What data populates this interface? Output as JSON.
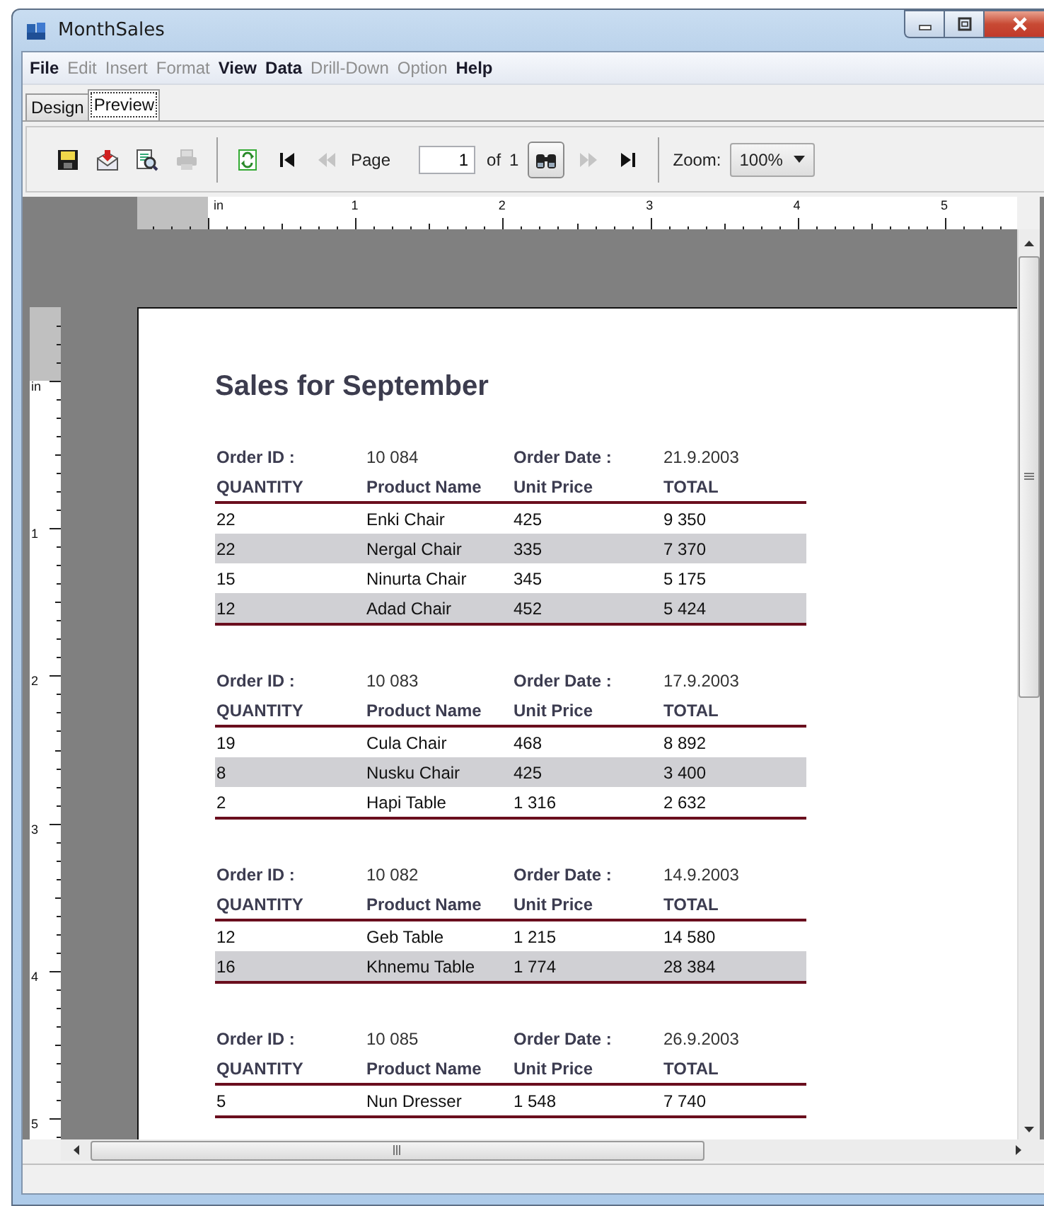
{
  "window": {
    "title": "MonthSales",
    "controls": [
      {
        "kind": "minimize"
      },
      {
        "kind": "maximize"
      },
      {
        "kind": "close"
      }
    ]
  },
  "menu": [
    {
      "label": "File",
      "disabled": false
    },
    {
      "label": "Edit",
      "disabled": true
    },
    {
      "label": "Insert",
      "disabled": true
    },
    {
      "label": "Format",
      "disabled": true
    },
    {
      "label": "View",
      "disabled": false
    },
    {
      "label": "Data",
      "disabled": false
    },
    {
      "label": "Drill-Down",
      "disabled": true
    },
    {
      "label": "Option",
      "disabled": true
    },
    {
      "label": "Help",
      "disabled": false
    }
  ],
  "tabs": [
    {
      "label": "Design",
      "selected": false
    },
    {
      "label": "Preview",
      "selected": true
    }
  ],
  "toolbar": {
    "items": [
      {
        "kind": "save",
        "disabled": false
      },
      {
        "kind": "export",
        "disabled": false
      },
      {
        "kind": "preview",
        "disabled": false
      },
      {
        "kind": "print",
        "disabled": true
      },
      {
        "kind": "separator"
      },
      {
        "kind": "refresh",
        "disabled": false
      },
      {
        "kind": "first",
        "disabled": false
      },
      {
        "kind": "prev",
        "disabled": true
      },
      {
        "kind": "label",
        "text": "Page"
      },
      {
        "kind": "input",
        "value": "1"
      },
      {
        "kind": "label",
        "text": "of"
      },
      {
        "kind": "label",
        "text": "1"
      },
      {
        "kind": "find",
        "disabled": false,
        "pressed": true
      },
      {
        "kind": "next",
        "disabled": true
      },
      {
        "kind": "last",
        "disabled": false
      },
      {
        "kind": "separator"
      },
      {
        "kind": "label",
        "text": "Zoom:"
      },
      {
        "kind": "dropdown",
        "value": "100%"
      }
    ]
  },
  "rulers": {
    "top_labels": [
      "in",
      "1",
      "2",
      "3",
      "4",
      "5"
    ],
    "left_labels": [
      "in",
      "1",
      "2",
      "3",
      "4",
      "5"
    ]
  },
  "report": {
    "title": "Sales for September",
    "orders": [
      {
        "id_label": "Order ID :",
        "id": "10 084",
        "date_label": "Order Date :",
        "date": "21.9.2003",
        "columns": [
          "QUANTITY",
          "Product Name",
          "Unit Price",
          "TOTAL"
        ],
        "rows": [
          [
            "22",
            "Enki Chair",
            "425",
            "9 350"
          ],
          [
            "22",
            "Nergal Chair",
            "335",
            "7 370"
          ],
          [
            "15",
            "Ninurta Chair",
            "345",
            "5 175"
          ],
          [
            "12",
            "Adad Chair",
            "452",
            "5 424"
          ]
        ]
      },
      {
        "id_label": "Order ID :",
        "id": "10 083",
        "date_label": "Order Date :",
        "date": "17.9.2003",
        "columns": [
          "QUANTITY",
          "Product Name",
          "Unit Price",
          "TOTAL"
        ],
        "rows": [
          [
            "19",
            "Cula Chair",
            "468",
            "8 892"
          ],
          [
            "8",
            "Nusku Chair",
            "425",
            "3 400"
          ],
          [
            "2",
            "Hapi Table",
            "1 316",
            "2 632"
          ]
        ]
      },
      {
        "id_label": "Order ID :",
        "id": "10 082",
        "date_label": "Order Date :",
        "date": "14.9.2003",
        "columns": [
          "QUANTITY",
          "Product Name",
          "Unit Price",
          "TOTAL"
        ],
        "rows": [
          [
            "12",
            "Geb Table",
            "1 215",
            "14 580"
          ],
          [
            "16",
            "Khnemu Table",
            "1 774",
            "28 384"
          ]
        ]
      },
      {
        "id_label": "Order ID :",
        "id": "10 085",
        "date_label": "Order Date :",
        "date": "26.9.2003",
        "columns": [
          "QUANTITY",
          "Product Name",
          "Unit Price",
          "TOTAL"
        ],
        "rows": [
          [
            "5",
            "Nun Dresser",
            "1 548",
            "7 740"
          ]
        ]
      }
    ]
  }
}
